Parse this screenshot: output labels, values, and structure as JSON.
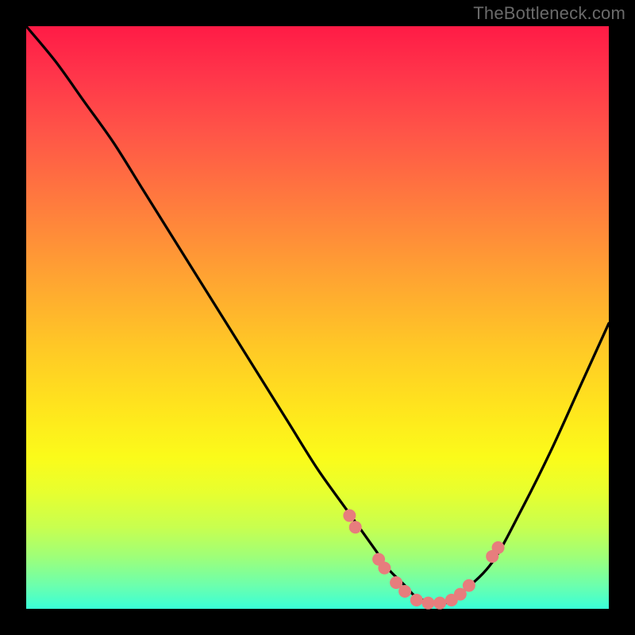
{
  "watermark": "TheBottleneck.com",
  "chart_data": {
    "type": "line",
    "title": "",
    "xlabel": "",
    "ylabel": "",
    "xlim": [
      0,
      100
    ],
    "ylim": [
      0,
      100
    ],
    "grid": false,
    "legend": false,
    "series": [
      {
        "name": "bottleneck-curve",
        "color": "#000000",
        "x": [
          0,
          5,
          10,
          15,
          20,
          25,
          30,
          35,
          40,
          45,
          50,
          55,
          60,
          62,
          65,
          67,
          70,
          72,
          75,
          80,
          85,
          90,
          95,
          100
        ],
        "y": [
          100,
          94,
          87,
          80,
          72,
          64,
          56,
          48,
          40,
          32,
          24,
          17,
          10,
          7,
          4,
          2,
          1,
          1,
          3,
          8,
          17,
          27,
          38,
          49
        ]
      }
    ],
    "markers": [
      {
        "name": "dots",
        "color": "#e77d7d",
        "radius": 8,
        "points": [
          {
            "x": 55.5,
            "y": 16.0
          },
          {
            "x": 56.5,
            "y": 14.0
          },
          {
            "x": 60.5,
            "y": 8.5
          },
          {
            "x": 61.5,
            "y": 7.0
          },
          {
            "x": 63.5,
            "y": 4.5
          },
          {
            "x": 65.0,
            "y": 3.0
          },
          {
            "x": 67.0,
            "y": 1.5
          },
          {
            "x": 69.0,
            "y": 1.0
          },
          {
            "x": 71.0,
            "y": 1.0
          },
          {
            "x": 73.0,
            "y": 1.5
          },
          {
            "x": 74.5,
            "y": 2.5
          },
          {
            "x": 76.0,
            "y": 4.0
          },
          {
            "x": 80.0,
            "y": 9.0
          },
          {
            "x": 81.0,
            "y": 10.5
          }
        ]
      }
    ]
  }
}
